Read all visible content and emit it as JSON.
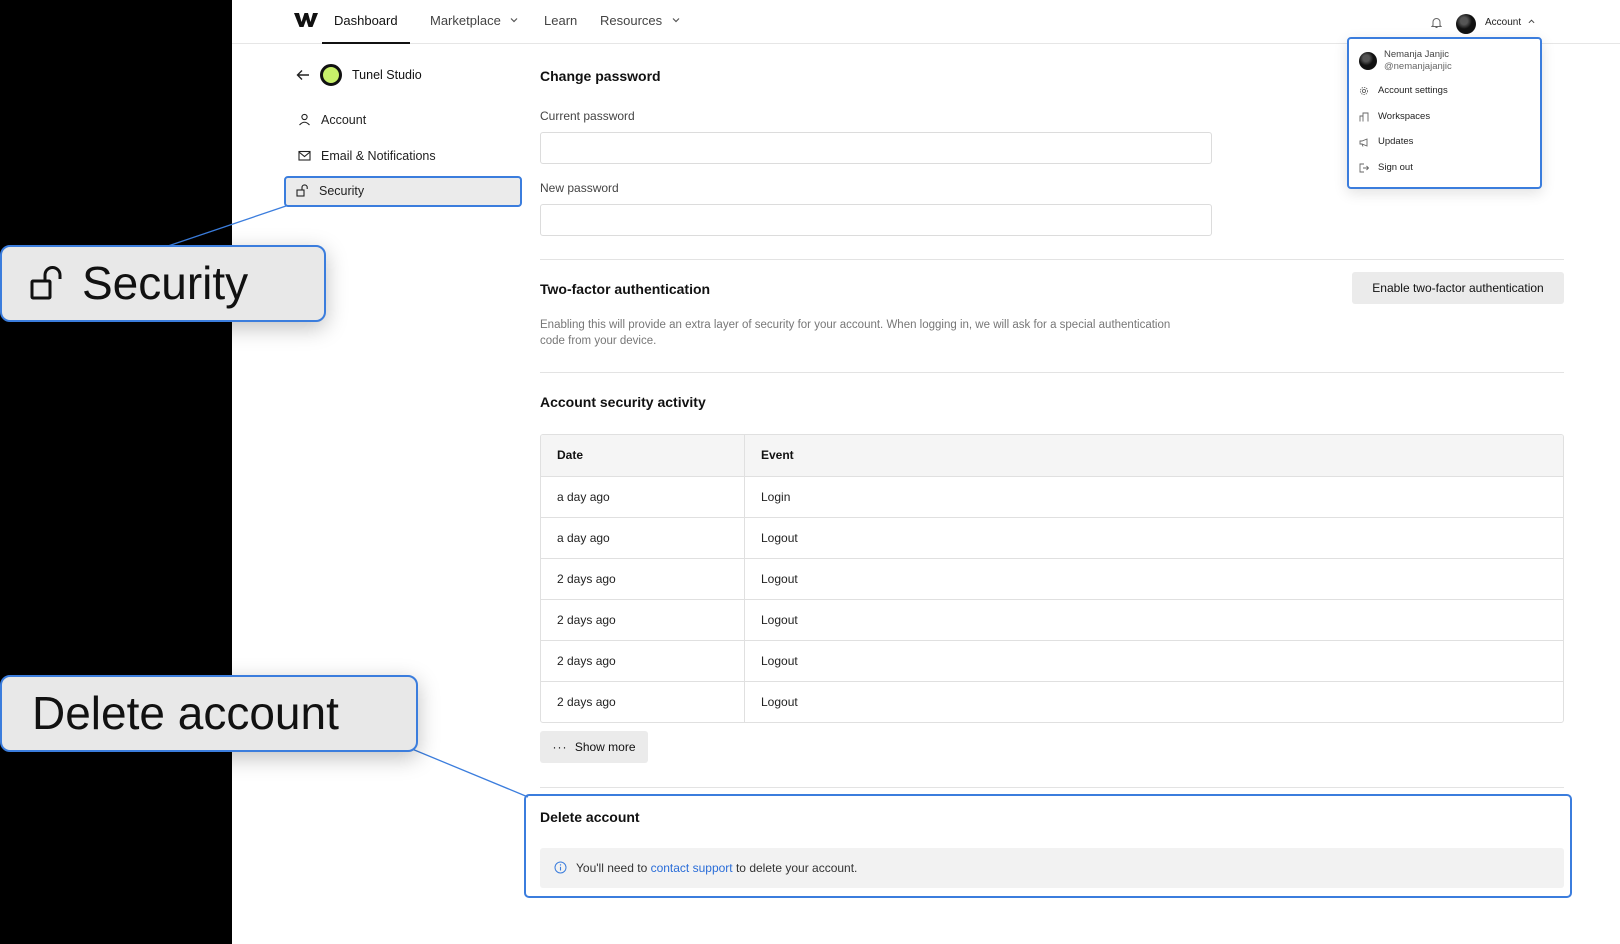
{
  "topnav": {
    "logo_icon": "webflow-logo-icon",
    "items": [
      {
        "label": "Dashboard",
        "active": true
      },
      {
        "label": "Marketplace",
        "has_dropdown": true
      },
      {
        "label": "Learn"
      },
      {
        "label": "Resources",
        "has_dropdown": true
      }
    ],
    "account_label": "Account"
  },
  "account_menu": {
    "user_name": "Nemanja Janjic",
    "user_handle": "@nemanjajanjic",
    "items": [
      {
        "label": "Account settings",
        "icon": "gear-icon"
      },
      {
        "label": "Workspaces",
        "icon": "building-icon"
      },
      {
        "label": "Updates",
        "icon": "megaphone-icon"
      },
      {
        "label": "Sign out",
        "icon": "sign-out-icon"
      }
    ]
  },
  "sidebar": {
    "workspace_name": "Tunel Studio",
    "workspace_color": "#c8f06a",
    "items": [
      {
        "label": "Account",
        "icon": "user-icon"
      },
      {
        "label": "Email & Notifications",
        "icon": "mail-icon"
      },
      {
        "label": "Security",
        "icon": "unlock-icon",
        "selected": true
      }
    ]
  },
  "change_password": {
    "title": "Change password",
    "current_label": "Current password",
    "current_value": "",
    "new_label": "New password",
    "new_value": ""
  },
  "two_factor": {
    "title": "Two-factor authentication",
    "button": "Enable two-factor authentication",
    "description": "Enabling this will provide an extra layer of security for your account. When logging in, we will ask for a special authentication code from your device."
  },
  "activity": {
    "title": "Account security activity",
    "headers": [
      "Date",
      "Event"
    ],
    "rows": [
      [
        "a day ago",
        "Login"
      ],
      [
        "a day ago",
        "Logout"
      ],
      [
        "2 days ago",
        "Logout"
      ],
      [
        "2 days ago",
        "Logout"
      ],
      [
        "2 days ago",
        "Logout"
      ],
      [
        "2 days ago",
        "Logout"
      ]
    ],
    "show_more": "Show more"
  },
  "delete_account": {
    "title": "Delete account",
    "notice_prefix": "You'll need to ",
    "notice_link": "contact support",
    "notice_suffix": " to delete your account."
  },
  "callouts": {
    "security": "Security",
    "delete": "Delete account"
  },
  "colors": {
    "accent": "#3b7ddd",
    "link": "#2a6dd8"
  }
}
